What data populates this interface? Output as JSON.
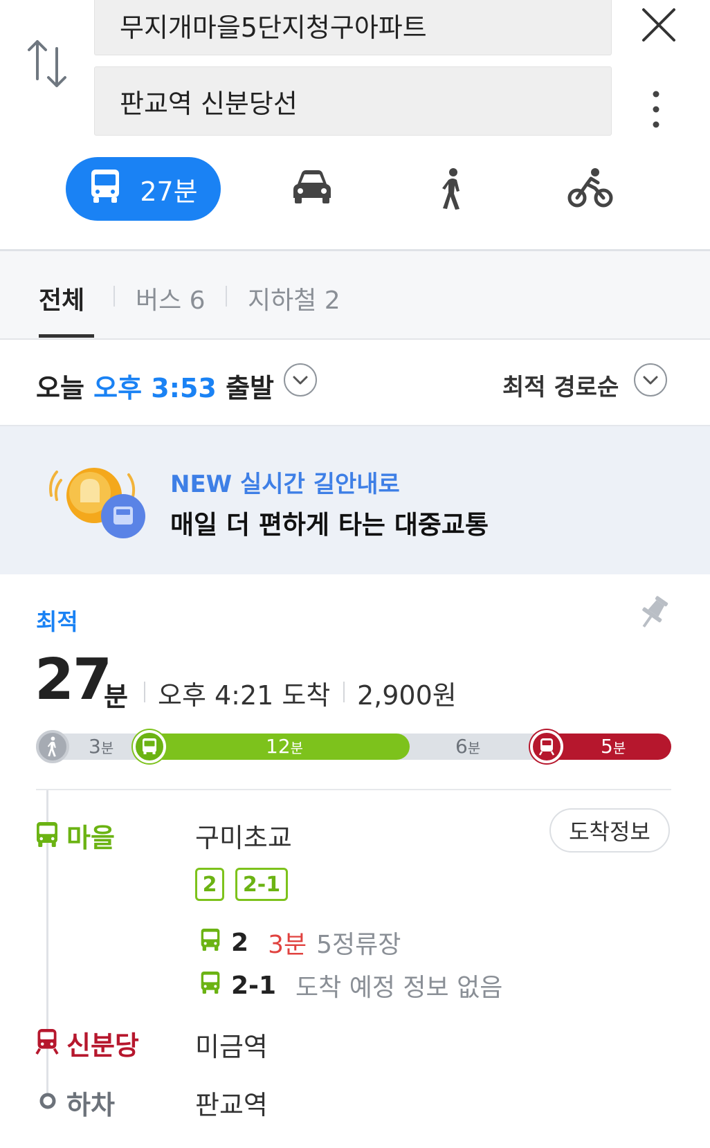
{
  "search": {
    "origin": "무지개마을5단지청구아파트",
    "destination": "판교역 신분당선"
  },
  "modes": {
    "transit_time": "27분",
    "items": [
      "bus-icon",
      "car-icon",
      "walk-icon",
      "bicycle-icon"
    ]
  },
  "filters": {
    "all": "전체",
    "bus": "버스 6",
    "subway": "지하철 2"
  },
  "departure": {
    "day": "오늘",
    "time": "오후 3:53",
    "suffix": "출발",
    "sort": "최적 경로순"
  },
  "banner": {
    "new_label": "NEW 실시간 길안내로",
    "main": "매일 더 편하게 타는 대중교통"
  },
  "route": {
    "tag": "최적",
    "total_min": "27",
    "total_unit": "분",
    "arrival": "오후 4:21 도착",
    "fare": "2,900원",
    "segments": [
      {
        "type": "walk",
        "min": "3",
        "unit": "분"
      },
      {
        "type": "bus",
        "min": "12",
        "unit": "분"
      },
      {
        "type": "wait",
        "min": "6",
        "unit": "분"
      },
      {
        "type": "subway",
        "min": "5",
        "unit": "분"
      }
    ],
    "steps": {
      "bus_label": "마을",
      "bus_stop": "구미초교",
      "arrival_info": "도착정보",
      "chips": [
        "2",
        "2-1"
      ],
      "lines": [
        {
          "num": "2",
          "eta": "3분",
          "stops": "5정류장"
        },
        {
          "num": "2-1",
          "status": "도착 예정 정보 없음"
        }
      ],
      "subway_label": "신분당",
      "subway_stop": "미금역",
      "alight_label": "하차",
      "alight_stop": "판교역"
    }
  },
  "colors": {
    "primary": "#1a82f4",
    "bus_green": "#7dc21c",
    "subway_red": "#b6172d"
  }
}
